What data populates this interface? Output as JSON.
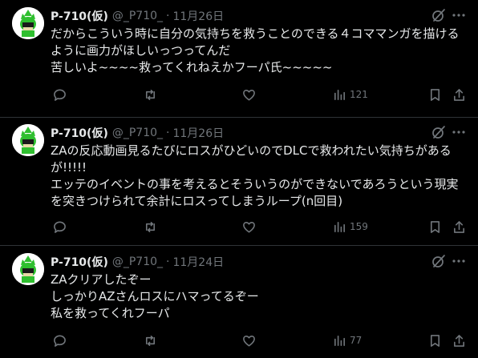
{
  "tweets": [
    {
      "author_name": "P-710(仮)",
      "handle": "@_P710_",
      "separator": "·",
      "date": "11月26日",
      "text": "だからこういう時に自分の気持ちを救うことのできる４コママンガを描ける\nように画力がほしいっつってんだ\n苦しいよ~~~~救ってくれねえかフーパ氏~~~~~",
      "views": "121"
    },
    {
      "author_name": "P-710(仮)",
      "handle": "@_P710_",
      "separator": "·",
      "date": "11月26日",
      "text": "ZAの反応動画見るたびにロスがひどいのでDLCで救われたい気持ちがある\nが!!!!!\nエッテのイベントの事を考えるとそういうのができないであろうという現実\nを突きつけられて余計にロスってしまうループ(n回目)",
      "views": "159"
    },
    {
      "author_name": "P-710(仮)",
      "handle": "@_P710_",
      "separator": "·",
      "date": "11月24日",
      "text": "ZAクリアしたぞー\nしっかりAZさんロスにハマってるぞー\n私を救ってくれフーパ",
      "views": "77"
    }
  ],
  "icons": {
    "reply": "reply-icon",
    "retweet": "retweet-icon",
    "like": "heart-icon",
    "views": "views-icon",
    "bookmark": "bookmark-icon",
    "share": "share-icon",
    "grok": "grok-icon",
    "more": "more-icon"
  },
  "colors": {
    "background": "#000000",
    "text": "#e7e9ea",
    "muted": "#71767b",
    "divider": "#2f3336",
    "avatar_accent": "#2fbf2f"
  }
}
